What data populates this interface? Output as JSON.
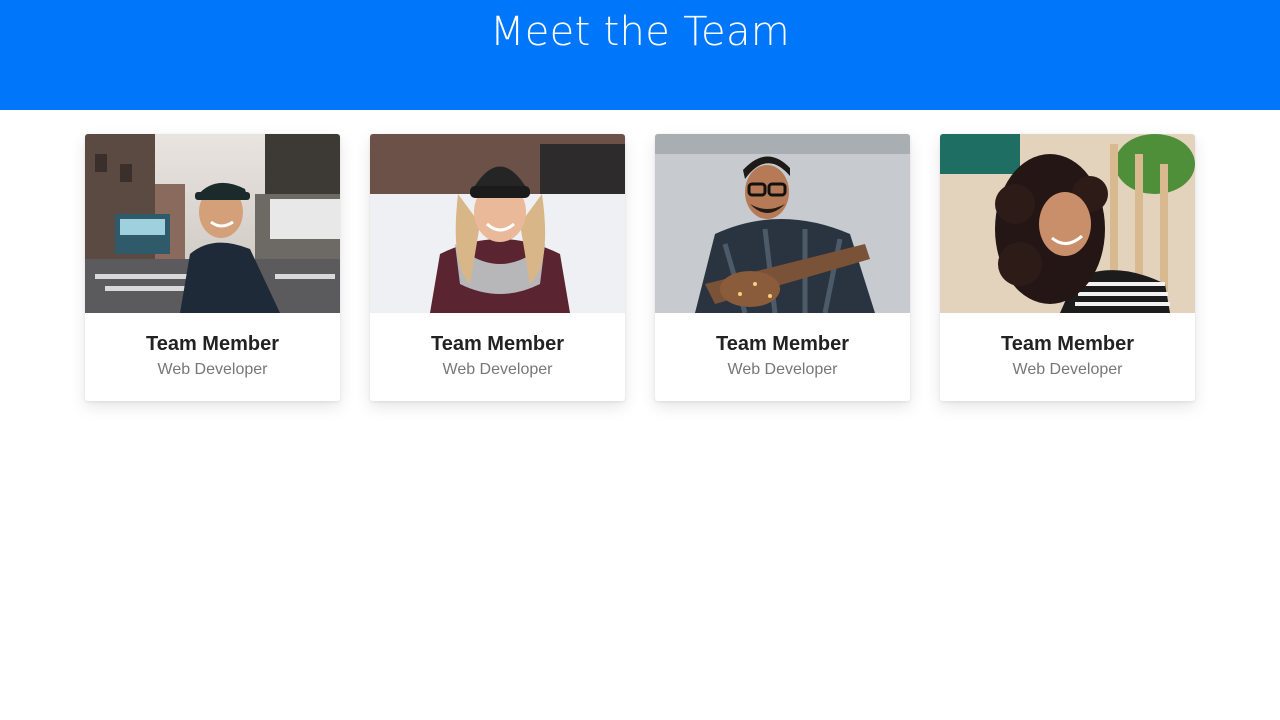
{
  "header": {
    "title": "Meet the Team",
    "background": "#0077fa"
  },
  "team": [
    {
      "name": "Team Member",
      "role": "Web Developer",
      "photo_icon": "young-man-cap-street-photo"
    },
    {
      "name": "Team Member",
      "role": "Web Developer",
      "photo_icon": "smiling-woman-beanie-scarf-photo"
    },
    {
      "name": "Team Member",
      "role": "Web Developer",
      "photo_icon": "man-glasses-guitar-photo"
    },
    {
      "name": "Team Member",
      "role": "Web Developer",
      "photo_icon": "curly-hair-woman-photo"
    }
  ]
}
